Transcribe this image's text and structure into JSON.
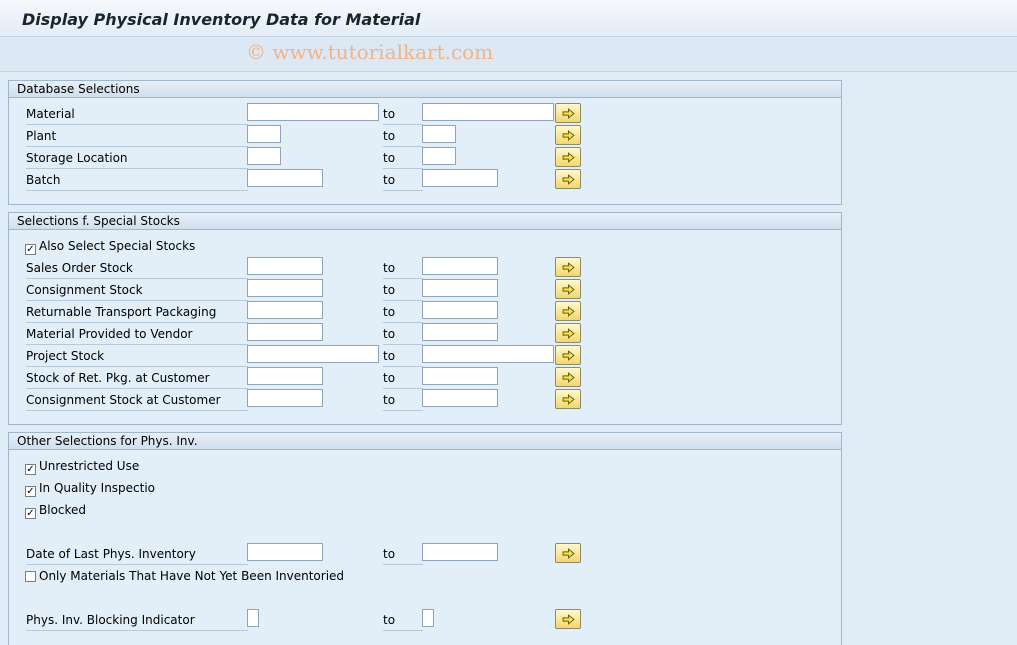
{
  "title": "Display Physical Inventory Data for Material",
  "watermark": "© www.tutorialkart.com",
  "to_label": "to",
  "database_selections": {
    "header": "Database Selections",
    "rows": [
      {
        "label": "Material",
        "from": "",
        "to": ""
      },
      {
        "label": "Plant",
        "from": "",
        "to": ""
      },
      {
        "label": "Storage Location",
        "from": "",
        "to": ""
      },
      {
        "label": "Batch",
        "from": "",
        "to": ""
      }
    ]
  },
  "special_stocks": {
    "header": "Selections f. Special Stocks",
    "also_select": {
      "label": "Also Select Special Stocks",
      "checked": true
    },
    "rows": [
      {
        "label": "Sales Order Stock",
        "from": "",
        "to": ""
      },
      {
        "label": "Consignment Stock",
        "from": "",
        "to": ""
      },
      {
        "label": "Returnable Transport Packaging",
        "from": "",
        "to": ""
      },
      {
        "label": "Material Provided to Vendor",
        "from": "",
        "to": ""
      },
      {
        "label": "Project Stock",
        "from": "",
        "to": ""
      },
      {
        "label": "Stock of Ret. Pkg. at Customer",
        "from": "",
        "to": ""
      },
      {
        "label": "Consignment Stock at Customer",
        "from": "",
        "to": ""
      }
    ]
  },
  "other_selections": {
    "header": "Other Selections for Phys. Inv.",
    "checkboxes": [
      {
        "label": "Unrestricted Use",
        "checked": true
      },
      {
        "label": "In Quality Inspectio",
        "checked": true
      },
      {
        "label": "Blocked",
        "checked": true
      }
    ],
    "date_row": {
      "label": "Date of Last Phys. Inventory",
      "from": "",
      "to": ""
    },
    "not_inventoried": {
      "label": "Only Materials That Have Not Yet Been Inventoried",
      "checked": false
    },
    "blocking_row": {
      "label": "Phys. Inv. Blocking Indicator",
      "from": "",
      "to": ""
    }
  },
  "icons": {
    "multiple_selection": "yellow-right-arrow-icon",
    "checkmark": "✓"
  },
  "colors": {
    "background": "#dfebf5",
    "button_yellow": "#f3d86a",
    "watermark": "#f2b487"
  }
}
